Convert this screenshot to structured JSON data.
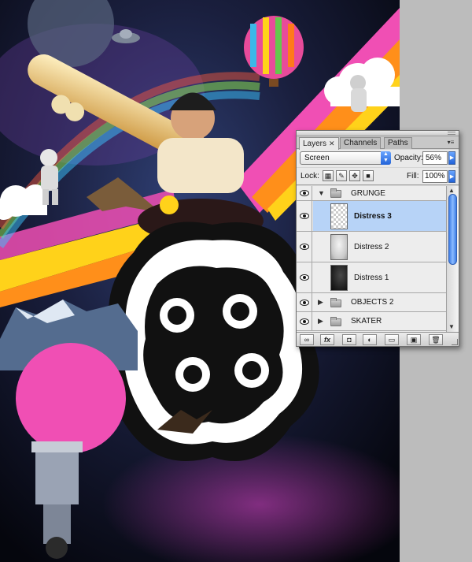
{
  "panel": {
    "tabs": [
      {
        "label": "Layers",
        "close": "✕"
      },
      {
        "label": "Channels"
      },
      {
        "label": "Paths"
      }
    ],
    "menu_icon": "panel-menu-icon",
    "blend_mode": "Screen",
    "opacity_label": "Opacity:",
    "opacity_value": "56%",
    "lock_label": "Lock:",
    "fill_label": "Fill:",
    "fill_value": "100%",
    "layers": [
      {
        "type": "group",
        "name": "GRUNGE",
        "expanded": true,
        "visible": true
      },
      {
        "type": "layer",
        "name": "Distress 3",
        "selected": true,
        "visible": true,
        "thumb": "transparent"
      },
      {
        "type": "layer",
        "name": "Distress 2",
        "selected": false,
        "visible": true,
        "thumb": "light"
      },
      {
        "type": "layer",
        "name": "Distress 1",
        "selected": false,
        "visible": true,
        "thumb": "dark"
      },
      {
        "type": "group",
        "name": "OBJECTS 2",
        "expanded": false,
        "visible": true
      },
      {
        "type": "group",
        "name": "SKATER",
        "expanded": false,
        "visible": true
      }
    ],
    "bottom_buttons": [
      "link-layers-icon",
      "fx-icon",
      "layer-mask-icon",
      "adjustment-layer-icon",
      "new-group-icon",
      "new-layer-icon",
      "trash-icon"
    ],
    "bottom_labels": {
      "fx": "fx"
    }
  },
  "colors": {
    "selected_row": "#b7d3f7",
    "accent_blue": "#2263d8",
    "poster_pink": "#f04fb4",
    "poster_yellow": "#ffd21a",
    "poster_orange": "#ff9a1a"
  }
}
